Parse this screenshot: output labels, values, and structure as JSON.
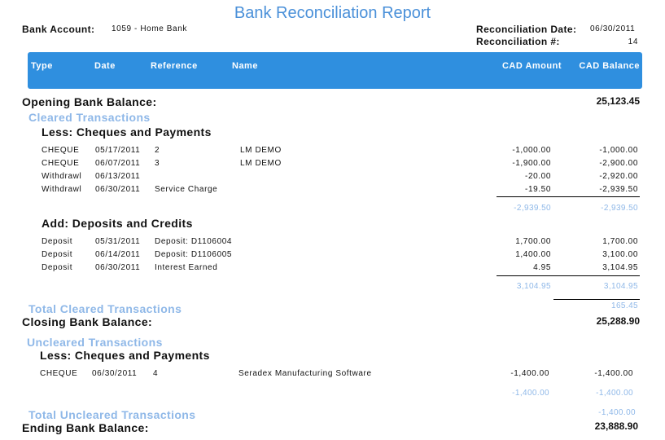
{
  "title": "Bank Reconciliation Report",
  "header": {
    "bank_account_label": "Bank Account:",
    "bank_account_value": "1059 - Home Bank",
    "recon_date_label": "Reconciliation Date:",
    "recon_date_value": "06/30/2011",
    "recon_num_label": "Reconciliation #:",
    "recon_num_value": "14"
  },
  "columns": {
    "type": "Type",
    "date": "Date",
    "reference": "Reference",
    "name": "Name",
    "amount": "CAD Amount",
    "balance": "CAD Balance"
  },
  "opening": {
    "label": "Opening Bank Balance:",
    "value": "25,123.45"
  },
  "cleared": {
    "heading": "Cleared Transactions",
    "cheques": {
      "heading": "Less: Cheques and Payments",
      "rows": [
        {
          "type": "CHEQUE",
          "date": "05/17/2011",
          "ref": "2",
          "name": "LM DEMO",
          "amount": "-1,000.00",
          "balance": "-1,000.00"
        },
        {
          "type": "CHEQUE",
          "date": "06/07/2011",
          "ref": "3",
          "name": "LM DEMO",
          "amount": "-1,900.00",
          "balance": "-2,900.00"
        },
        {
          "type": "Withdrawl",
          "date": "06/13/2011",
          "ref": "",
          "name": "",
          "amount": "-20.00",
          "balance": "-2,920.00"
        },
        {
          "type": "Withdrawl",
          "date": "06/30/2011",
          "ref": "Service Charge",
          "name": "",
          "amount": "-19.50",
          "balance": "-2,939.50"
        }
      ],
      "total_amount": "-2,939.50",
      "total_balance": "-2,939.50"
    },
    "deposits": {
      "heading": "Add: Deposits and Credits",
      "rows": [
        {
          "type": "Deposit",
          "date": "05/31/2011",
          "ref": "Deposit: D1106004",
          "name": "",
          "amount": "1,700.00",
          "balance": "1,700.00"
        },
        {
          "type": "Deposit",
          "date": "06/14/2011",
          "ref": "Deposit: D1106005",
          "name": "",
          "amount": "1,400.00",
          "balance": "3,100.00"
        },
        {
          "type": "Deposit",
          "date": "06/30/2011",
          "ref": "Interest Earned",
          "name": "",
          "amount": "4.95",
          "balance": "3,104.95"
        }
      ],
      "total_amount": "3,104.95",
      "total_balance": "3,104.95"
    },
    "total_label": "Total Cleared Transactions",
    "total_value": "165.45"
  },
  "closing": {
    "label": "Closing Bank Balance:",
    "value": "25,288.90"
  },
  "uncleared": {
    "heading": "Uncleared Transactions",
    "cheques": {
      "heading": "Less: Cheques and Payments",
      "rows": [
        {
          "type": "CHEQUE",
          "date": "06/30/2011",
          "ref": "4",
          "name": "Seradex Manufacturing Software",
          "amount": "-1,400.00",
          "balance": "-1,400.00"
        }
      ],
      "total_amount": "-1,400.00",
      "total_balance": "-1,400.00"
    },
    "total_label": "Total Uncleared Transactions",
    "total_value": "-1,400.00"
  },
  "ending": {
    "label": "Ending Bank Balance:",
    "value": "23,888.90"
  }
}
